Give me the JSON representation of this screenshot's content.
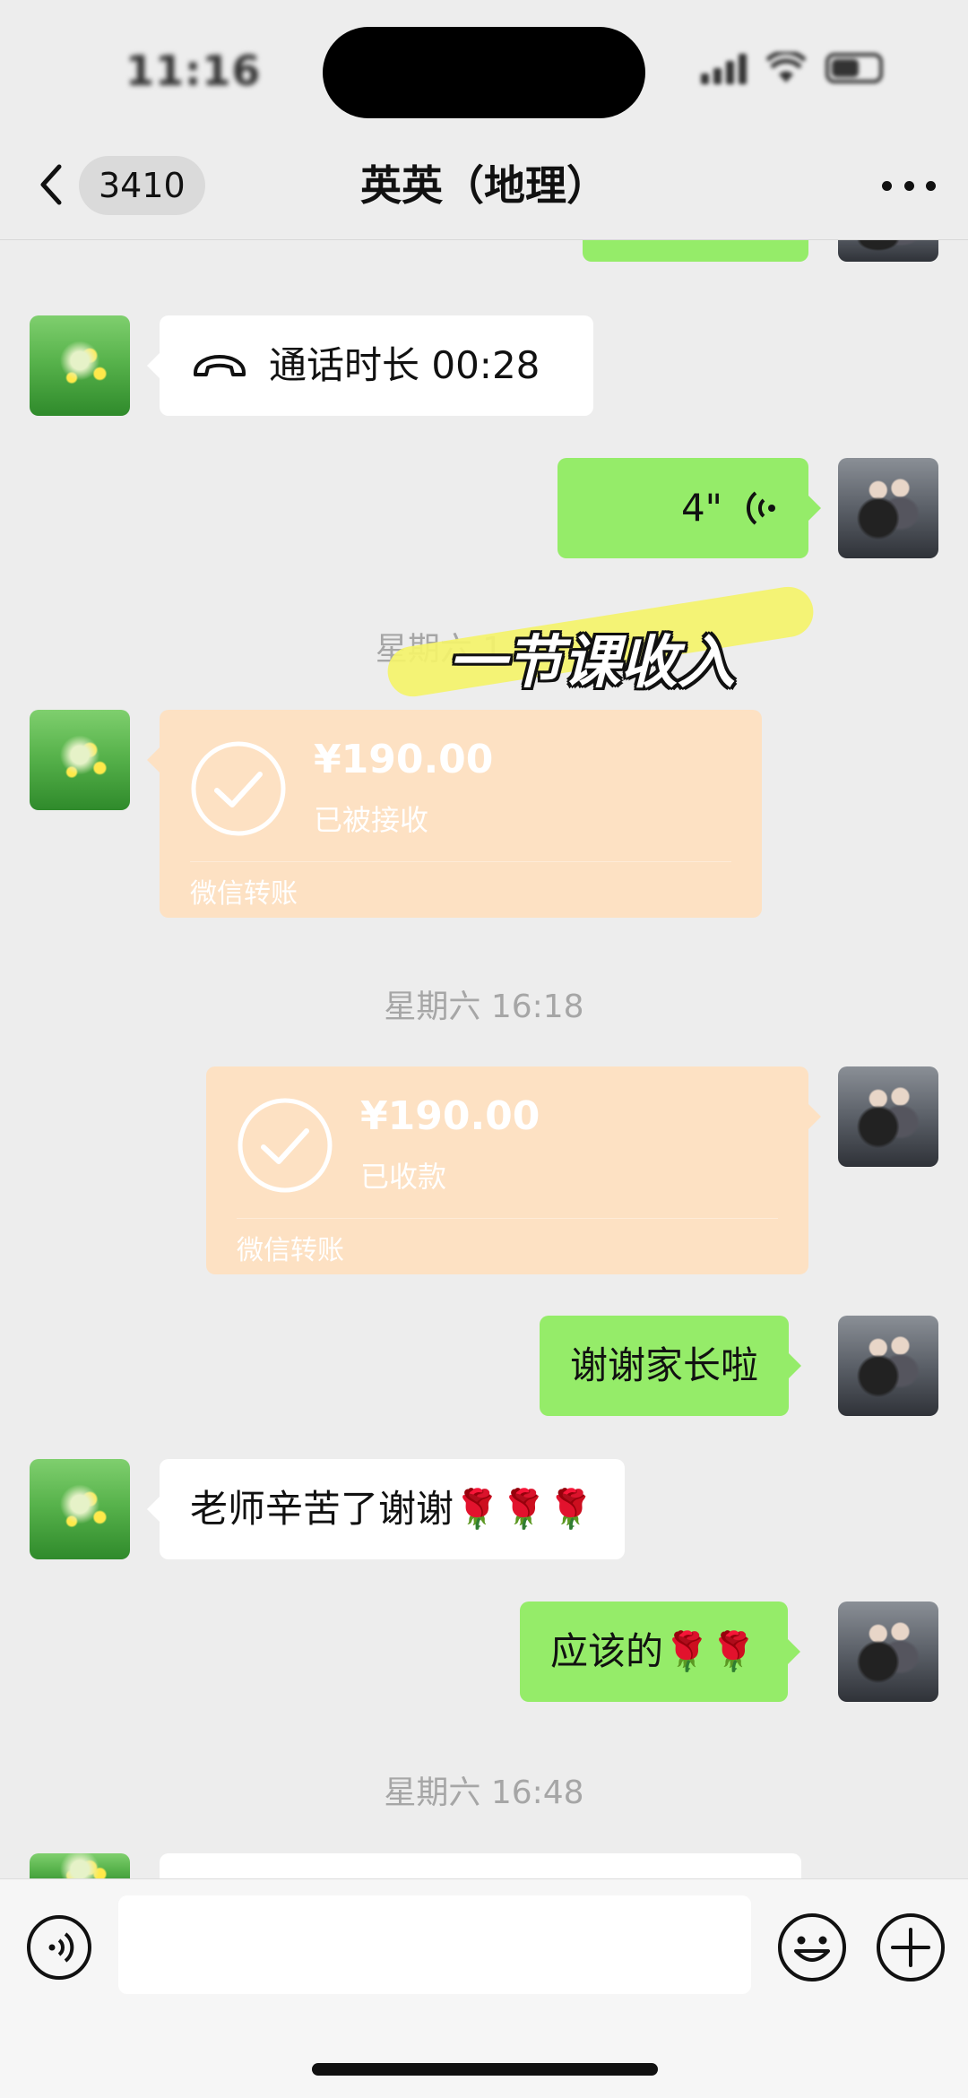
{
  "status_bar": {
    "time": "11:16"
  },
  "header": {
    "unread_count": "3410",
    "title": "英英（地理）"
  },
  "messages": {
    "call": {
      "text": "通话时长 00:28"
    },
    "voice": {
      "duration": "4\""
    },
    "time_1": "星期六 1",
    "transfer_received": {
      "amount": "¥190.00",
      "status": "已被接收",
      "footer": "微信转账"
    },
    "time_2": "星期六 16:18",
    "transfer_collected": {
      "amount": "¥190.00",
      "status": "已收款",
      "footer": "微信转账"
    },
    "msg_thanks": "谢谢家长啦",
    "msg_reply": "老师辛苦了谢谢🌹🌹🌹",
    "msg_ok": "应该的🌹🌹",
    "time_3": "星期六 16:48"
  },
  "overlay": {
    "caption": "一节课收入",
    "highlight_color": "#f4f36a"
  },
  "colors": {
    "bubble_self": "#95ec69",
    "bubble_other": "#ffffff",
    "transfer": "#fde1c3",
    "background": "#ededed"
  },
  "input_bar": {
    "value": ""
  }
}
